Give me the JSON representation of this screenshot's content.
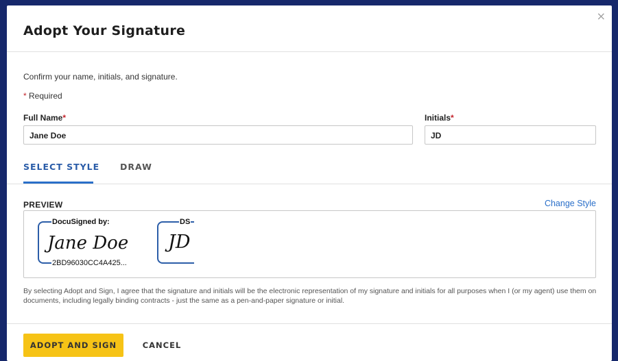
{
  "dialog": {
    "title": "Adopt Your Signature",
    "close_glyph": "×",
    "intro": "Confirm your name, initials, and signature.",
    "required_marker": "*",
    "required_text": " Required"
  },
  "fields": {
    "full_name": {
      "label": "Full Name",
      "marker": "*",
      "value": "Jane Doe"
    },
    "initials": {
      "label": "Initials",
      "marker": "*",
      "value": "JD"
    }
  },
  "tabs": [
    {
      "label": "SELECT STYLE",
      "active": true
    },
    {
      "label": "DRAW",
      "active": false
    }
  ],
  "preview": {
    "label": "PREVIEW",
    "change_style": "Change Style",
    "signature": {
      "header": "DocuSigned by:",
      "script": "Jane Doe",
      "footer": "2BD96030CC4A425..."
    },
    "initials": {
      "header": "DS",
      "script": "JD"
    },
    "accent_color": "#2b5da8"
  },
  "legal_text": "By selecting Adopt and Sign, I agree that the signature and initials will be the electronic representation of my signature and initials for all purposes when I (or my agent) use them on documents, including legally binding contracts - just the same as a pen-and-paper signature or initial.",
  "buttons": {
    "adopt": "ADOPT AND SIGN",
    "cancel": "CANCEL"
  },
  "colors": {
    "backdrop": "#16286b",
    "primary_button": "#f6c316",
    "link": "#2a6fc9",
    "required": "#c3232b"
  }
}
